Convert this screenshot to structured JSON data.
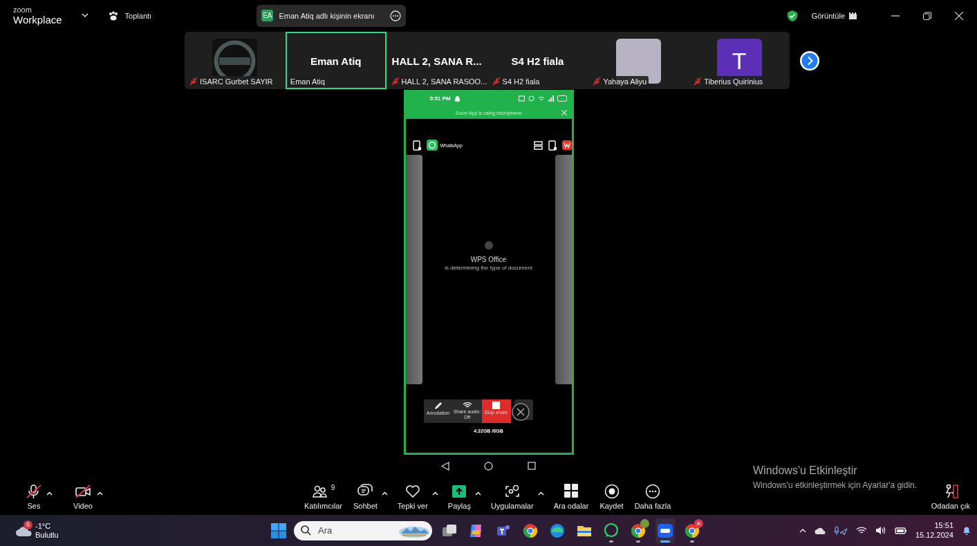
{
  "title_bar": {
    "logo_top": "zoom",
    "logo_bottom": "Workplace",
    "meeting_label": "Toplantı",
    "share_pill": {
      "initials": "EA",
      "text": "Eman Atiq adlı kişinin ekranı"
    },
    "view_label": "Görüntüle"
  },
  "gallery": [
    {
      "kind": "logo",
      "name": "ISARC Gurbet SAYIR",
      "muted": true,
      "speaking": false
    },
    {
      "kind": "name",
      "big": "Eman Atiq",
      "name": "Eman Atiq",
      "muted": false,
      "speaking": true
    },
    {
      "kind": "name",
      "big": "HALL 2, SANA R...",
      "name": "HALL 2, SANA RASOO...",
      "muted": true,
      "speaking": false
    },
    {
      "kind": "name",
      "big": "S4 H2 fiala",
      "name": "S4 H2 fiala",
      "muted": true,
      "speaking": false
    },
    {
      "kind": "photo",
      "name": "Yahaya Aliyu",
      "muted": true,
      "speaking": false
    },
    {
      "kind": "initial",
      "initial": "T",
      "name": "Tiberius Quirinius",
      "muted": true,
      "speaking": false
    }
  ],
  "shared_screen": {
    "time": "5:51 PM",
    "notice": "Zoom App is using microphone",
    "app_label": "WhatsApp",
    "loading_title": "WPS Office",
    "loading_text": "is determining the type of document",
    "share_controls": [
      {
        "kind": "pen",
        "label": "Annotation"
      },
      {
        "kind": "audio",
        "label": "Share audio: Off"
      },
      {
        "kind": "stop",
        "label": "Stop share"
      }
    ],
    "memory": "4.32GB /6GB"
  },
  "activation": {
    "title": "Windows'u Etkinleştir",
    "text": "Windows'u etkinleştirmek için Ayarlar'a gidin."
  },
  "toolbar": [
    {
      "kind": "mic",
      "label": "Ses",
      "off": true,
      "caret": true
    },
    {
      "kind": "video",
      "label": "Video",
      "off": true,
      "caret": true
    },
    {
      "kind": "people",
      "label": "Katılımcılar",
      "count": "9",
      "caret": false
    },
    {
      "kind": "chat",
      "label": "Sohbet",
      "caret": true
    },
    {
      "kind": "heart",
      "label": "Tepki ver",
      "caret": true
    },
    {
      "kind": "share",
      "label": "Paylaş",
      "caret": true
    },
    {
      "kind": "apps",
      "label": "Uygulamalar",
      "caret": true
    },
    {
      "kind": "grid",
      "label": "Ara odalar",
      "caret": false
    },
    {
      "kind": "record",
      "label": "Kaydet",
      "caret": false
    },
    {
      "kind": "more",
      "label": "Daha fazla",
      "caret": false
    },
    {
      "kind": "leave",
      "label": "Odadan çık",
      "caret": false
    }
  ],
  "taskbar": {
    "weather": {
      "badge": "5",
      "temp": "-1°C",
      "desc": "Bulutlu"
    },
    "search": {
      "placeholder": "Ara"
    },
    "apps": [
      {
        "kind": "taskview",
        "running": false,
        "active": false
      },
      {
        "kind": "copilot",
        "running": false,
        "active": false
      },
      {
        "kind": "teams",
        "running": false,
        "active": false
      },
      {
        "kind": "chrome",
        "running": false,
        "active": false
      },
      {
        "kind": "edge",
        "running": false,
        "active": false
      },
      {
        "kind": "folder",
        "running": false,
        "active": false
      },
      {
        "kind": "whatsapp",
        "running": true,
        "active": false
      },
      {
        "kind": "chrome",
        "running": true,
        "active": false,
        "badge": {
          "color": "#6f9a3c"
        }
      },
      {
        "kind": "zoom",
        "running": true,
        "active": true
      },
      {
        "kind": "chrome",
        "running": true,
        "active": false,
        "badge": {
          "text": "A",
          "color": "#d8394a"
        }
      }
    ],
    "time": "15:51",
    "date": "15.12.2024"
  }
}
